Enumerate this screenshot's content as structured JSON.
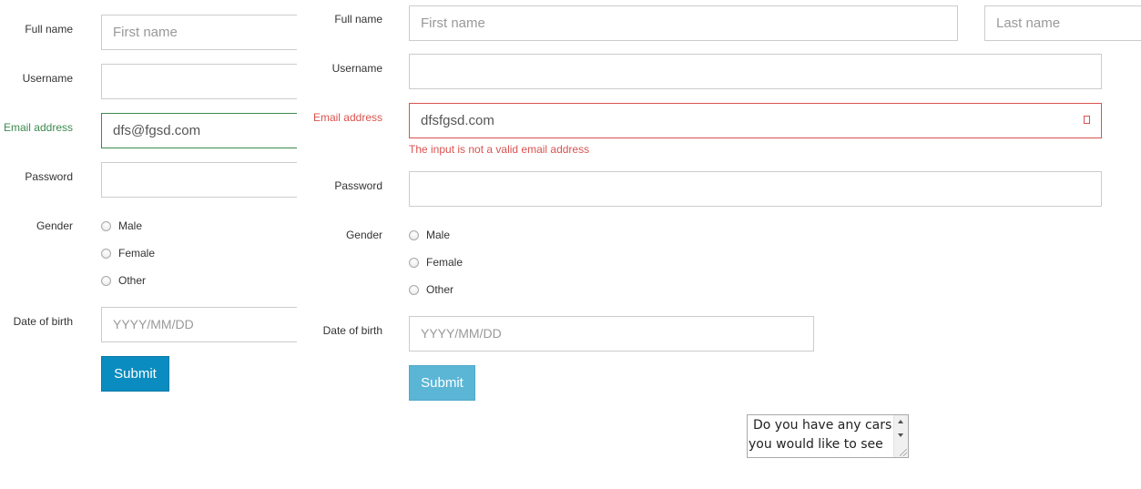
{
  "left_form": {
    "full_name_label": "Full name",
    "first_name_placeholder": "First name",
    "username_label": "Username",
    "email_label": "Email address",
    "email_value": "dfs@fgsd.com",
    "password_label": "Password",
    "gender_label": "Gender",
    "gender_options": [
      "Male",
      "Female",
      "Other"
    ],
    "dob_label": "Date of birth",
    "dob_placeholder": "YYYY/MM/DD",
    "submit_label": "Submit"
  },
  "right_form": {
    "full_name_label": "Full name",
    "first_name_placeholder": "First name",
    "last_name_placeholder": "Last name",
    "username_label": "Username",
    "email_label": "Email address",
    "email_value": "dfsfgsd.com",
    "email_error": "The input is not a valid email address",
    "password_label": "Password",
    "gender_label": "Gender",
    "gender_options": [
      "Male",
      "Female",
      "Other"
    ],
    "dob_label": "Date of birth",
    "dob_placeholder": "YYYY/MM/DD",
    "submit_label": "Submit"
  },
  "textarea": {
    "lines": [
      "Do you have any cars",
      "you would like to see"
    ]
  },
  "colors": {
    "success": "#3c8a4e",
    "error": "#d9534f",
    "primary": "#0a8cc0",
    "primary_disabled": "#5bb6d6"
  }
}
